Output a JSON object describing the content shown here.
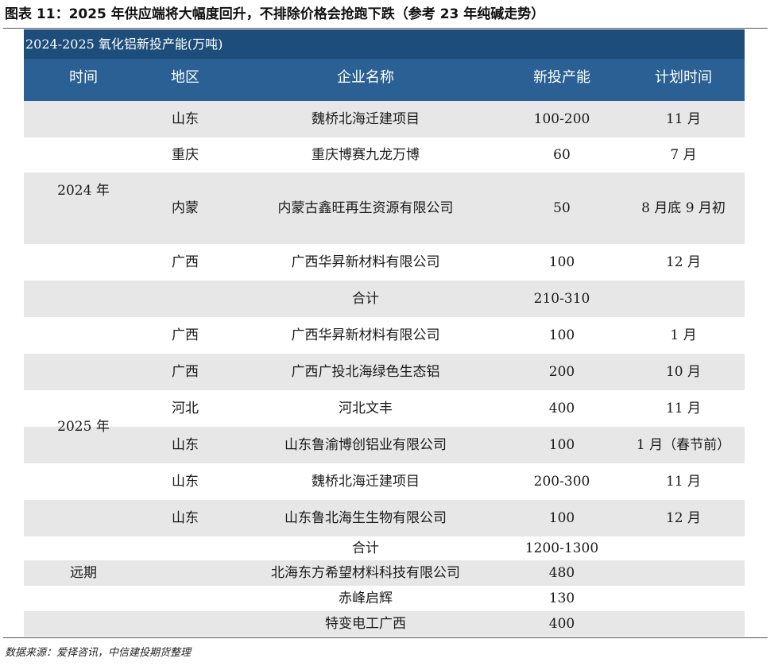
{
  "figure_title": "图表 11：2025 年供应端将大幅度回升，不排除价格会抢跑下跌（参考 23 年纯碱走势）",
  "table": {
    "caption": "2024-2025 氧化铝新投产能(万吨)",
    "headers": [
      "时间",
      "地区",
      "企业名称",
      "新投产能",
      "计划时间"
    ],
    "groups": [
      {
        "period": "2024 年",
        "rows": [
          {
            "region": "山东",
            "company": "魏桥北海迁建项目",
            "capacity": "100-200",
            "plan": "11 月"
          },
          {
            "region": "重庆",
            "company": "重庆博赛九龙万博",
            "capacity": "60",
            "plan": "7 月"
          },
          {
            "region": "内蒙",
            "company": "内蒙古鑫旺再生资源有限公司",
            "capacity": "50",
            "plan": "8 月底 9 月初"
          },
          {
            "region": "广西",
            "company": "广西华昇新材料有限公司",
            "capacity": "100",
            "plan": "12 月"
          }
        ],
        "total_label": "合计",
        "total": "210-310"
      },
      {
        "period": "2025 年",
        "rows": [
          {
            "region": "广西",
            "company": "广西华昇新材料有限公司",
            "capacity": "100",
            "plan": "1 月"
          },
          {
            "region": "广西",
            "company": "广西广投北海绿色生态铝",
            "capacity": "200",
            "plan": "10 月"
          },
          {
            "region": "河北",
            "company": "河北文丰",
            "capacity": "400",
            "plan": "11 月"
          },
          {
            "region": "山东",
            "company": "山东鲁渝博创铝业有限公司",
            "capacity": "100",
            "plan": "1 月（春节前）"
          },
          {
            "region": "山东",
            "company": "魏桥北海迁建项目",
            "capacity": "200-300",
            "plan": "11 月"
          },
          {
            "region": "山东",
            "company": "山东鲁北海生生物有限公司",
            "capacity": "100",
            "plan": "12 月"
          }
        ],
        "total_label": "合计",
        "total": "1200-1300"
      },
      {
        "period": "远期",
        "rows": [
          {
            "region": "",
            "company": "北海东方希望材料科技有限公司",
            "capacity": "480",
            "plan": ""
          },
          {
            "region": "",
            "company": "赤峰启辉",
            "capacity": "130",
            "plan": ""
          },
          {
            "region": "",
            "company": "特变电工广西",
            "capacity": "400",
            "plan": ""
          }
        ]
      }
    ]
  },
  "source": "数据来源：爱择咨讯，中信建投期货整理",
  "colors": {
    "caption_bg": "#1d4d7a",
    "header_bg": "#2a6093",
    "row_shade": "#e7e7e7"
  }
}
